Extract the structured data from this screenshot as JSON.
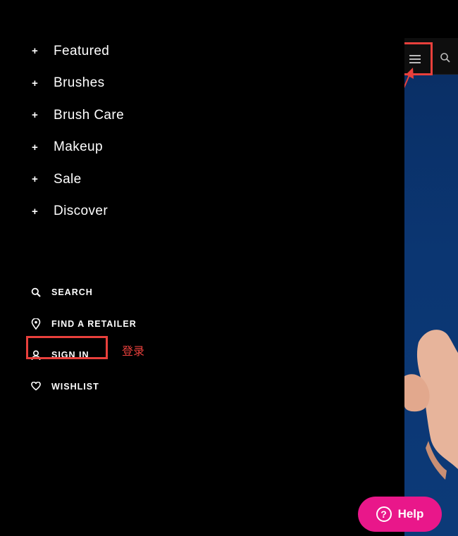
{
  "drawer": {
    "nav_items": [
      {
        "label": "Featured"
      },
      {
        "label": "Brushes"
      },
      {
        "label": "Brush Care"
      },
      {
        "label": "Makeup"
      },
      {
        "label": "Sale"
      },
      {
        "label": "Discover"
      }
    ],
    "expand_symbol": "+",
    "utility_links": [
      {
        "label": "SEARCH",
        "icon": "search-icon"
      },
      {
        "label": "FIND A RETAILER",
        "icon": "location-pin-icon"
      },
      {
        "label": "SIGN IN",
        "icon": "user-icon"
      },
      {
        "label": "WISHLIST",
        "icon": "heart-icon"
      }
    ]
  },
  "annotation": {
    "sign_in_note": "登录",
    "color": "#e8403c"
  },
  "help": {
    "label": "Help",
    "icon_glyph": "?",
    "color": "#e9178a"
  },
  "header": {
    "menu_icon": "hamburger-icon",
    "search_icon": "search-icon"
  }
}
